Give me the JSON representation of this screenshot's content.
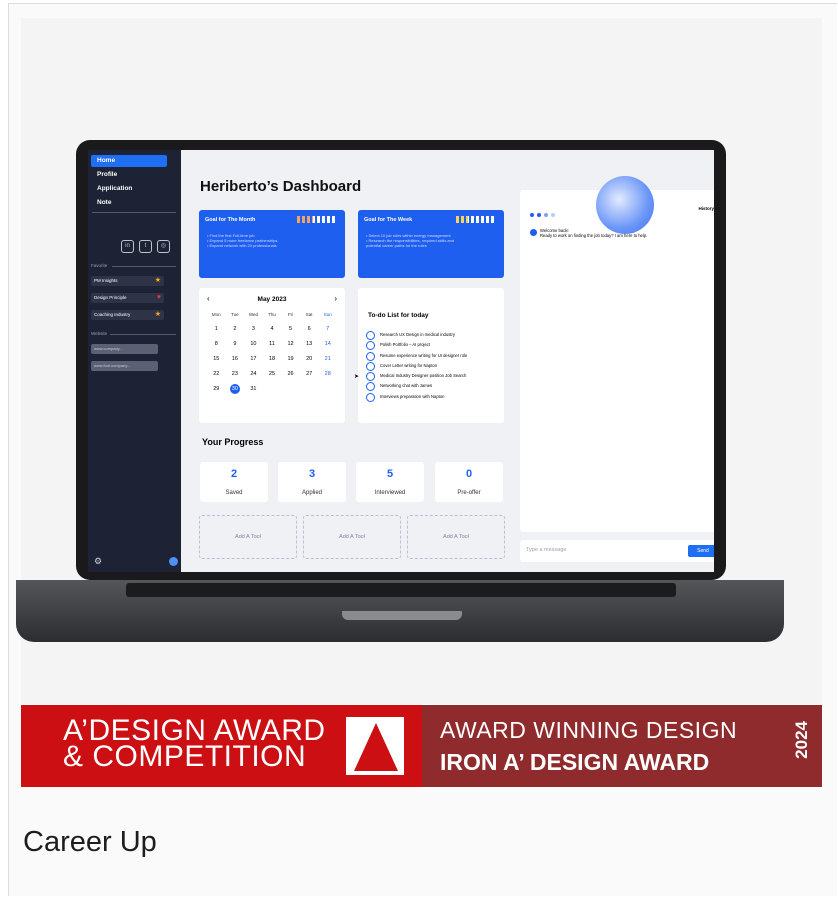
{
  "caption": "Career Up",
  "banner": {
    "left_line1": "A’DESIGN AWARD",
    "left_line2": "& COMPETITION",
    "right_line1": "AWARD WINNING DESIGN",
    "right_line2": "IRON A’ DESIGN AWARD",
    "year": "2024"
  },
  "dashboard": {
    "title": "Heriberto’s  Dashboard",
    "sidebar": {
      "items": [
        "Home",
        "Profile",
        "Application",
        "Note"
      ],
      "social_icons": [
        "linkedin-icon",
        "twitter-icon",
        "instagram-icon"
      ],
      "favorite_label": "Favorite",
      "favorites": [
        {
          "label": "PM Insights",
          "badge": "star"
        },
        {
          "label": "Design Principle",
          "badge": "heart"
        },
        {
          "label": "Coaching Industry",
          "badge": "star"
        }
      ],
      "website_label": "Website",
      "websites": [
        "www.company...",
        "www.fool.company..."
      ]
    },
    "goal_month": {
      "title": "Goal for The Month",
      "progress": 0.4,
      "lines": [
        "• Find the first Full-time job",
        "• Expand 5 more freelance partnerships",
        "• Expand network with 20 professionals"
      ]
    },
    "goal_week": {
      "title": "Goal for The Week",
      "progress": 0.3,
      "lines": [
        "• Select 10 job roles within energy management",
        "• Research the responsibilities, required skills and",
        "  potential career paths for the roles"
      ]
    },
    "calendar": {
      "month": "May 2023",
      "weekdays": [
        "Mon",
        "Tue",
        "Wed",
        "Thu",
        "Fri",
        "Sat",
        "Sun"
      ],
      "days": [
        "1",
        "2",
        "3",
        "4",
        "5",
        "6",
        "7",
        "8",
        "9",
        "10",
        "11",
        "12",
        "13",
        "14",
        "15",
        "16",
        "17",
        "18",
        "19",
        "20",
        "21",
        "22",
        "23",
        "24",
        "25",
        "26",
        "27",
        "28",
        "29",
        "30",
        "31"
      ],
      "selected": "30"
    },
    "todo": {
      "title": "To-do List for today",
      "items": [
        "Research UX Design in medical industry",
        "Polish Portfolio – AI project",
        "Resume experience writing for UI designer role",
        "Cover Letter writing for Napton",
        "Medical Industry Designer position Job Search",
        "Networking chat with James",
        "Interviews preparation with Napton"
      ]
    },
    "progress": {
      "title": "Your Progress",
      "stats": [
        {
          "value": "2",
          "label": "Saved"
        },
        {
          "value": "3",
          "label": "Applied"
        },
        {
          "value": "5",
          "label": "Interviewed"
        },
        {
          "value": "0",
          "label": "Pre-offer"
        }
      ],
      "tools": [
        "Add A Tool",
        "Add A Tool",
        "Add A Tool"
      ]
    },
    "chat": {
      "history": "History",
      "message_line1": "Welcome back!",
      "message_line2": "Ready to work on finding the job today? I am here to help.",
      "placeholder": "Type a message",
      "send": "Send"
    }
  }
}
